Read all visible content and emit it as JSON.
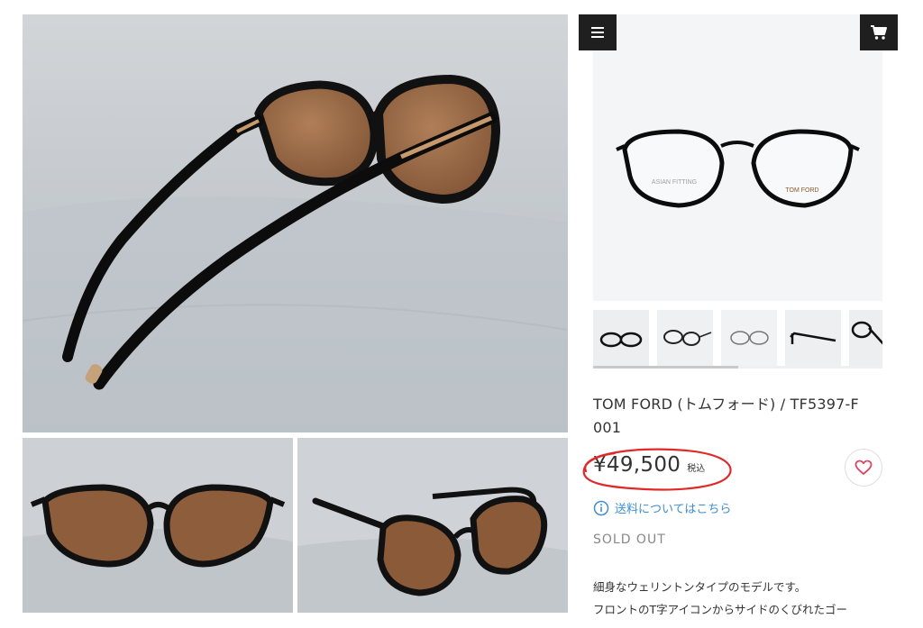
{
  "header": {
    "menu_icon": "hamburger-menu-icon",
    "cart_icon": "shopping-cart-icon"
  },
  "product": {
    "title": "TOM FORD (トムフォード) / TF5397-F 001",
    "price": "¥49,500",
    "tax_label": "税込",
    "shipping_link": "送料についてはこちら",
    "status": "SOLD OUT",
    "description": [
      "細身なウェリントンタイプのモデルです。",
      "フロントのT字アイコンからサイドのくびれたゴー"
    ],
    "frame_print_left": "ASIAN FITTING",
    "frame_print_right": "TOM FORD"
  },
  "thumbnails": {
    "count": 5,
    "scroll_fraction": 0.5
  },
  "colors": {
    "link": "#3e8ed0",
    "button_dark": "#1f1f1f",
    "annotation_red": "#e02a2a",
    "heart": "#e0455f"
  }
}
